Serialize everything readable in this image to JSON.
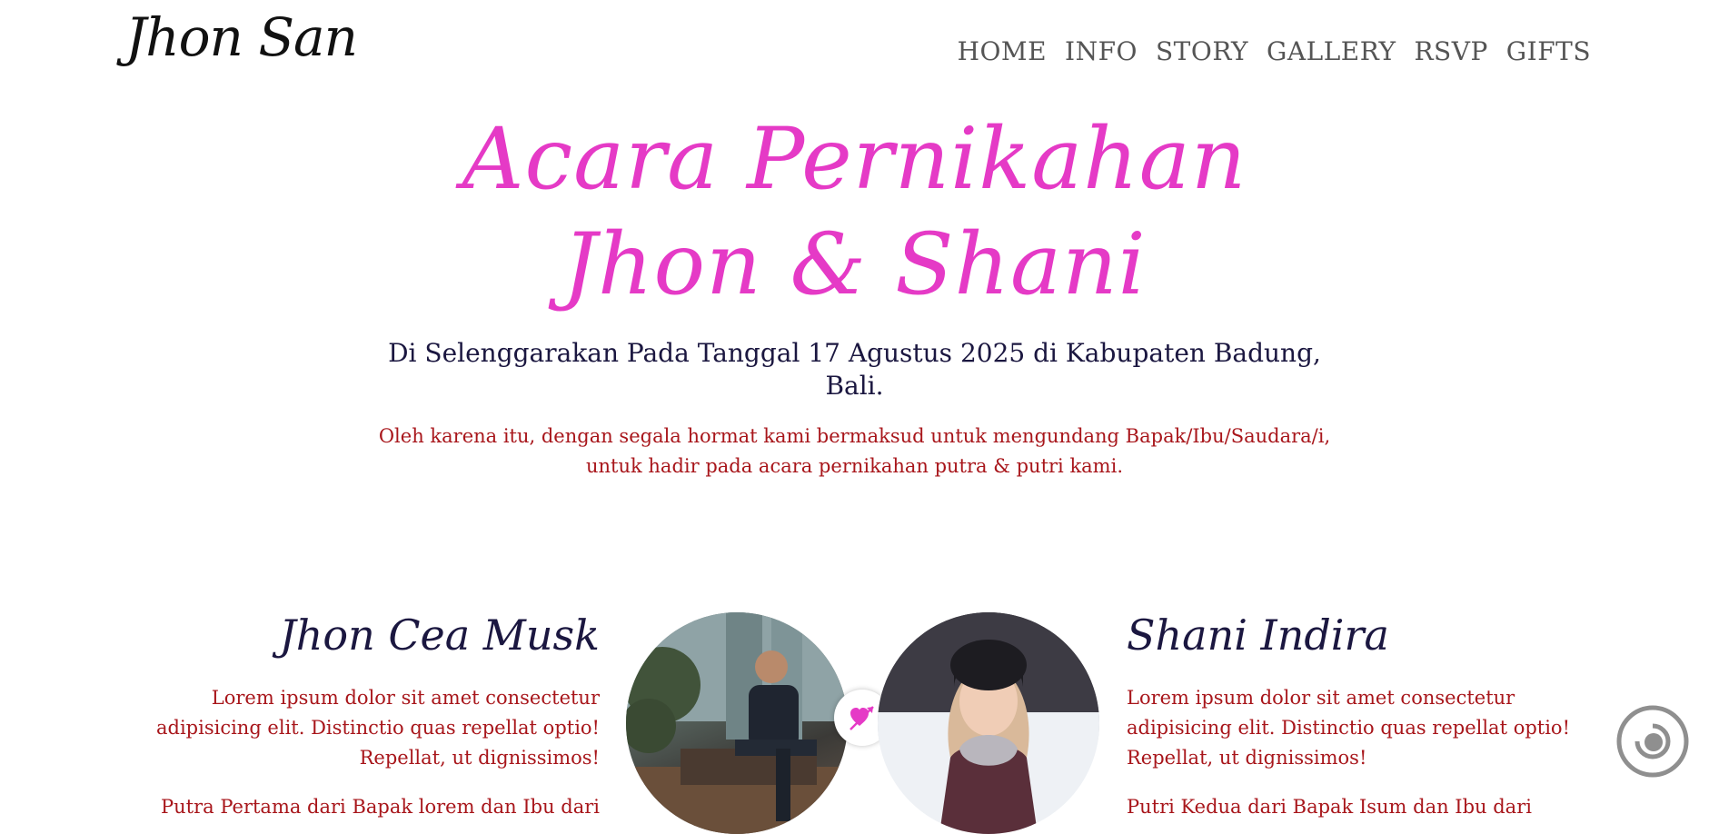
{
  "header": {
    "logo": "Jhon San",
    "nav": [
      "HOME",
      "INFO",
      "STORY",
      "GALLERY",
      "RSVP",
      "GIFTS"
    ]
  },
  "hero": {
    "title_line1": "Acara Pernikahan",
    "title_line2": "Jhon & Shani",
    "subtitle": "Di Selenggarakan Pada Tanggal 17 Agustus 2025 di Kabupaten Badung, Bali.",
    "invitation": "Oleh karena itu, dengan segala hormat kami bermaksud untuk mengundang Bapak/Ibu/Saudara/i, untuk hadir pada acara pernikahan putra & putri kami."
  },
  "couple": {
    "groom": {
      "name": "Jhon Cea Musk",
      "bio": "Lorem ipsum dolor sit amet consectetur adipisicing elit. Distinctio quas repellat optio! Repellat, ut dignissimos!",
      "parents": "Putra Pertama dari Bapak lorem dan Ibu dari"
    },
    "bride": {
      "name": "Shani Indira",
      "bio": "Lorem ipsum dolor sit amet consectetur adipisicing elit. Distinctio quas repellat optio! Repellat, ut dignissimos!",
      "parents": "Putri Kedua dari Bapak Isum dan Ibu dari"
    },
    "badge_icon": "heart-arrow-icon"
  },
  "audio": {
    "icon": "music-disc-icon"
  },
  "colors": {
    "accent": "#e53ac6",
    "heading": "#1b1740",
    "body_text": "#a8161b",
    "nav": "#555555"
  }
}
